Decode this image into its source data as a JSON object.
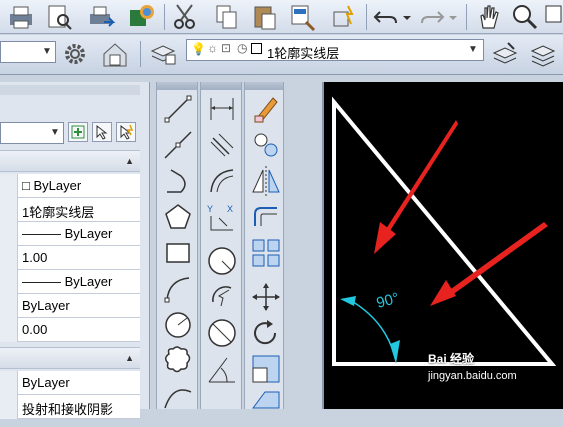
{
  "layer_toolbar": {
    "layer_name": "1轮廓实线层"
  },
  "properties": {
    "rows_general": [
      "□ ByLayer",
      "1轮廓实线层",
      "——— ByLayer",
      "1.00",
      "——— ByLayer",
      "ByLayer",
      "0.00"
    ],
    "rows_plot": [
      "ByLayer",
      "投射和接收阴影"
    ]
  },
  "canvas": {
    "angle_label": "90°"
  },
  "watermark": {
    "text": "jingyan.baidu.com",
    "brand": "Bai 经验"
  },
  "colors": {
    "canvas_bg": "#000000",
    "triangle": "#ffffff",
    "arrow": "#e8231f",
    "dimension": "#22c8e0"
  }
}
